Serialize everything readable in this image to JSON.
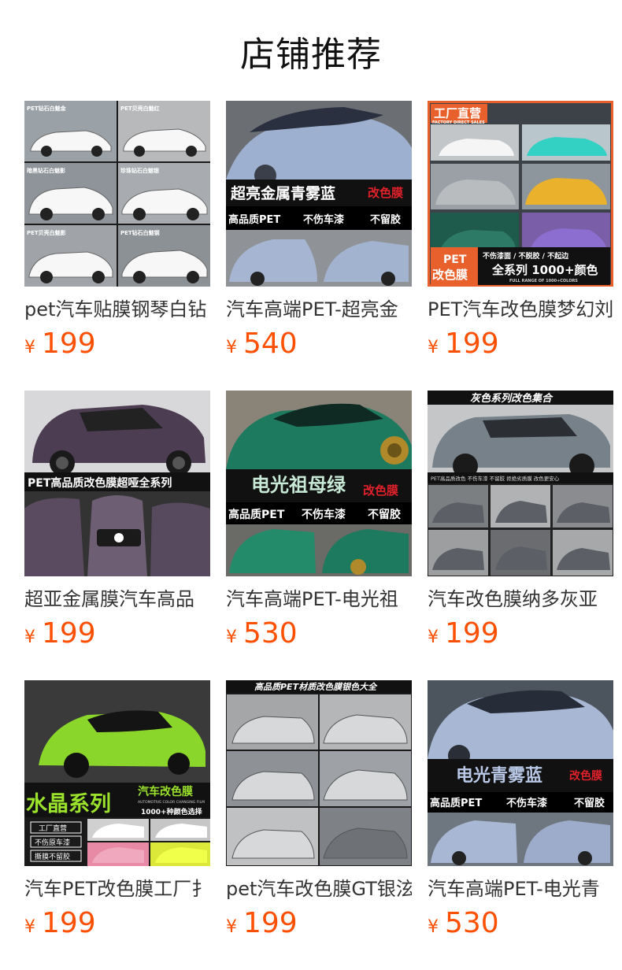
{
  "header": {
    "title": "店铺推荐"
  },
  "currency_symbol": "¥",
  "products": [
    {
      "title": "pet汽车贴膜钢琴白钻",
      "price": "199",
      "thumb": {
        "labels": [
          "PET钻石白魅金",
          "PET贝壳白魅红",
          "暗黑钻石白魅影",
          "珍珠钻石白魅银",
          "PET贝壳白魅影",
          "PET钻石白魅钢"
        ]
      }
    },
    {
      "title": "汽车高端PET-超亮金",
      "price": "540",
      "thumb": {
        "headline": "超亮金属青雾蓝",
        "tag": "改色膜",
        "feat1": "高品质PET",
        "feat2": "不伤车漆",
        "feat3": "不留胶"
      }
    },
    {
      "title": "PET汽车改色膜梦幻刘",
      "price": "199",
      "thumb": {
        "badge": "工厂直营",
        "badge_sub": "FACTORY DIRECT SALES",
        "pet": "PET",
        "sub": "改色膜",
        "notes": "不伤漆面 / 不脱胶 / 不起边",
        "series": "全系列 1000+颜色",
        "series_sub": "FULL RANGE OF 1000+COLORS"
      }
    },
    {
      "title": "超亚金属膜汽车高品",
      "price": "199",
      "thumb": {
        "banner": "PET高品质改色膜超哑全系列"
      }
    },
    {
      "title": "汽车高端PET-电光祖",
      "price": "530",
      "thumb": {
        "headline": "电光祖母绿",
        "tag": "改色膜",
        "feat1": "高品质PET",
        "feat2": "不伤车漆",
        "feat3": "不留胶"
      }
    },
    {
      "title": "汽车改色膜纳多灰亚",
      "price": "199",
      "thumb": {
        "banner": "灰色系列改色集合",
        "strip": "PET高品质改色  不伤车漆  不留胶  拒绝劣质膜  改色更安心"
      }
    },
    {
      "title": "汽车PET改色膜工厂扌",
      "price": "199",
      "thumb": {
        "headline": "水晶系列",
        "side": "汽车改色膜",
        "side_sub": "AUTOMOTIVE COLOR CHANGING FILM",
        "count": "1000+种颜色选择",
        "b1": "工厂直营",
        "b2": "不伤原车漆",
        "b3": "撕膜不留胶"
      }
    },
    {
      "title": "pet汽车改色膜GT银泫",
      "price": "199",
      "thumb": {
        "banner": "高品质PET材质改色膜银色大全"
      }
    },
    {
      "title": "汽车高端PET-电光青",
      "price": "530",
      "thumb": {
        "headline": "电光青雾蓝",
        "tag": "改色膜",
        "feat1": "高品质PET",
        "feat2": "不伤车漆",
        "feat3": "不留胶"
      }
    }
  ],
  "colors": {
    "price": "#ff5000",
    "title": "#333333",
    "heading": "#111111",
    "accent_red": "#d9231c",
    "orange_brand": "#e8612c"
  },
  "icons": {
    "product_image": "car-photo-icon"
  }
}
